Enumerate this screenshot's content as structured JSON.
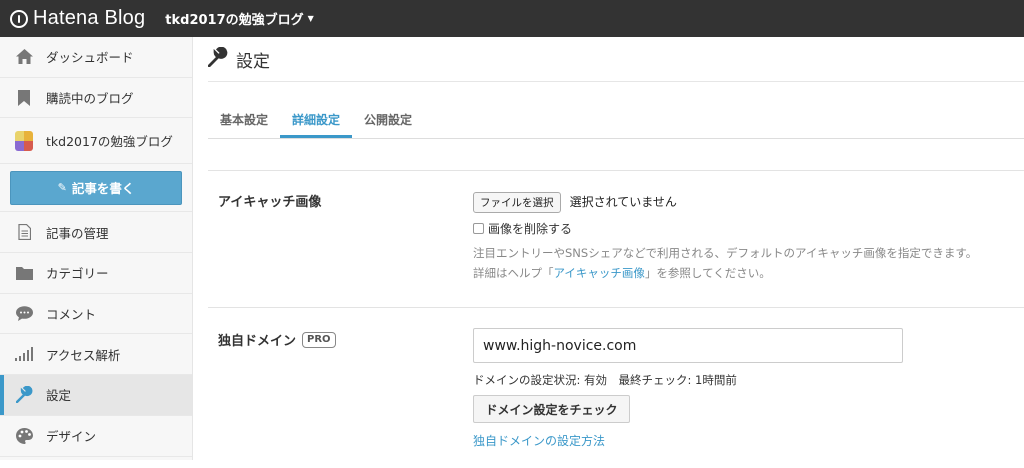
{
  "topbar": {
    "logo_text": "Hatena Blog",
    "blog_switch": "tkd2017の勉強ブログ"
  },
  "sidebar": {
    "items": [
      {
        "label": "ダッシュボード"
      },
      {
        "label": "購読中のブログ"
      },
      {
        "label": "tkd2017の勉強ブログ"
      },
      {
        "label": "記事を書く"
      },
      {
        "label": "記事の管理"
      },
      {
        "label": "カテゴリー"
      },
      {
        "label": "コメント"
      },
      {
        "label": "アクセス解析"
      },
      {
        "label": "設定"
      },
      {
        "label": "デザイン"
      }
    ],
    "active": "設定",
    "accent": "#3b98c9"
  },
  "page": {
    "title": "設定"
  },
  "tabs": [
    {
      "label": "基本設定"
    },
    {
      "label": "詳細設定"
    },
    {
      "label": "公開設定"
    }
  ],
  "eyecatch": {
    "label": "アイキャッチ画像",
    "file_button": "ファイルを選択",
    "file_status": "選択されていません",
    "delete_label": "画像を削除する",
    "help_line1": "注目エントリーやSNSシェアなどで利用される、デフォルトのアイキャッチ画像を指定できます。",
    "help_prefix": "詳細はヘルプ「",
    "help_link": "アイキャッチ画像",
    "help_suffix": "」を参照してください。"
  },
  "domain": {
    "label": "独自ドメイン",
    "badge": "PRO",
    "value": "www.high-novice.com",
    "status": "ドメインの設定状況: 有効　最終チェック: 1時間前",
    "check_button": "ドメイン設定をチェック",
    "howto_link": "独自ドメインの設定方法"
  }
}
